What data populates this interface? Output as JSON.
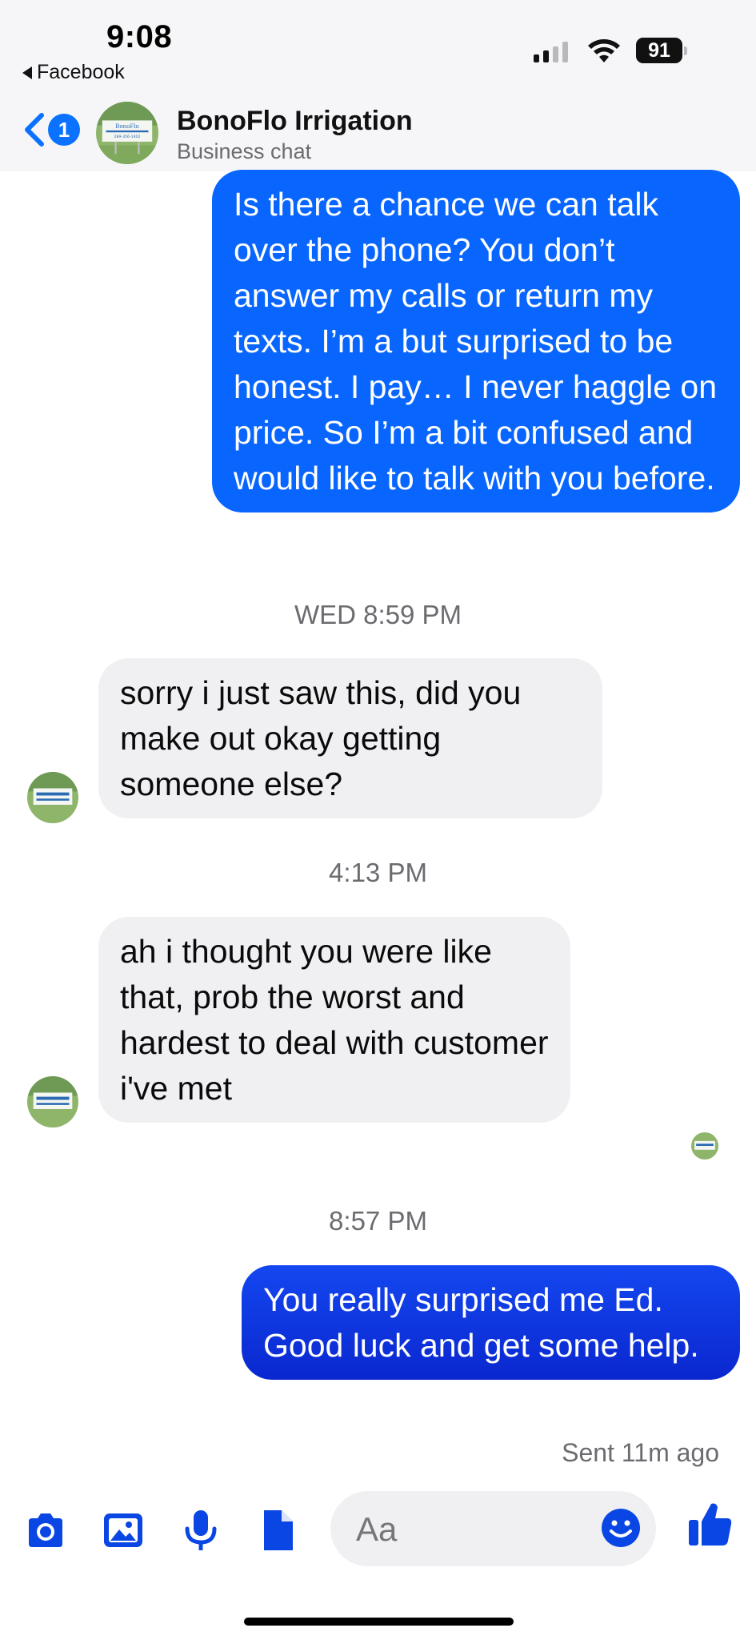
{
  "status_bar": {
    "time": "9:08",
    "back_app": "Facebook",
    "battery": "91"
  },
  "header": {
    "unread_count": "1",
    "title": "BonoFlo Irrigation",
    "subtitle": "Business chat",
    "avatar_logo_text": "BonoFlo",
    "avatar_phone_text": "289-356-1402"
  },
  "messages": [
    {
      "direction": "out",
      "text": "Is there a chance we can talk over the phone? You don’t answer my calls or return my texts. I’m a but surprised to be honest. I pay… I never haggle on price. So I’m a bit confused and would like to talk with you before."
    },
    {
      "direction": "in",
      "text": "sorry i just saw this, did you make out okay getting someone else?"
    },
    {
      "direction": "in",
      "text": "ah i thought you were like that, prob the worst and hardest to deal with customer i've met"
    },
    {
      "direction": "out",
      "text": "You really surprised me Ed. Good luck and get some help."
    }
  ],
  "timestamps": [
    "WED 8:59 PM",
    "4:13 PM",
    "8:57 PM"
  ],
  "sent_status": "Sent 11m ago",
  "composer": {
    "placeholder": "Aa"
  },
  "colors": {
    "accent": "#0866ff",
    "last_bubble": "#0a27cf",
    "incoming_bubble": "#f0f0f3"
  }
}
